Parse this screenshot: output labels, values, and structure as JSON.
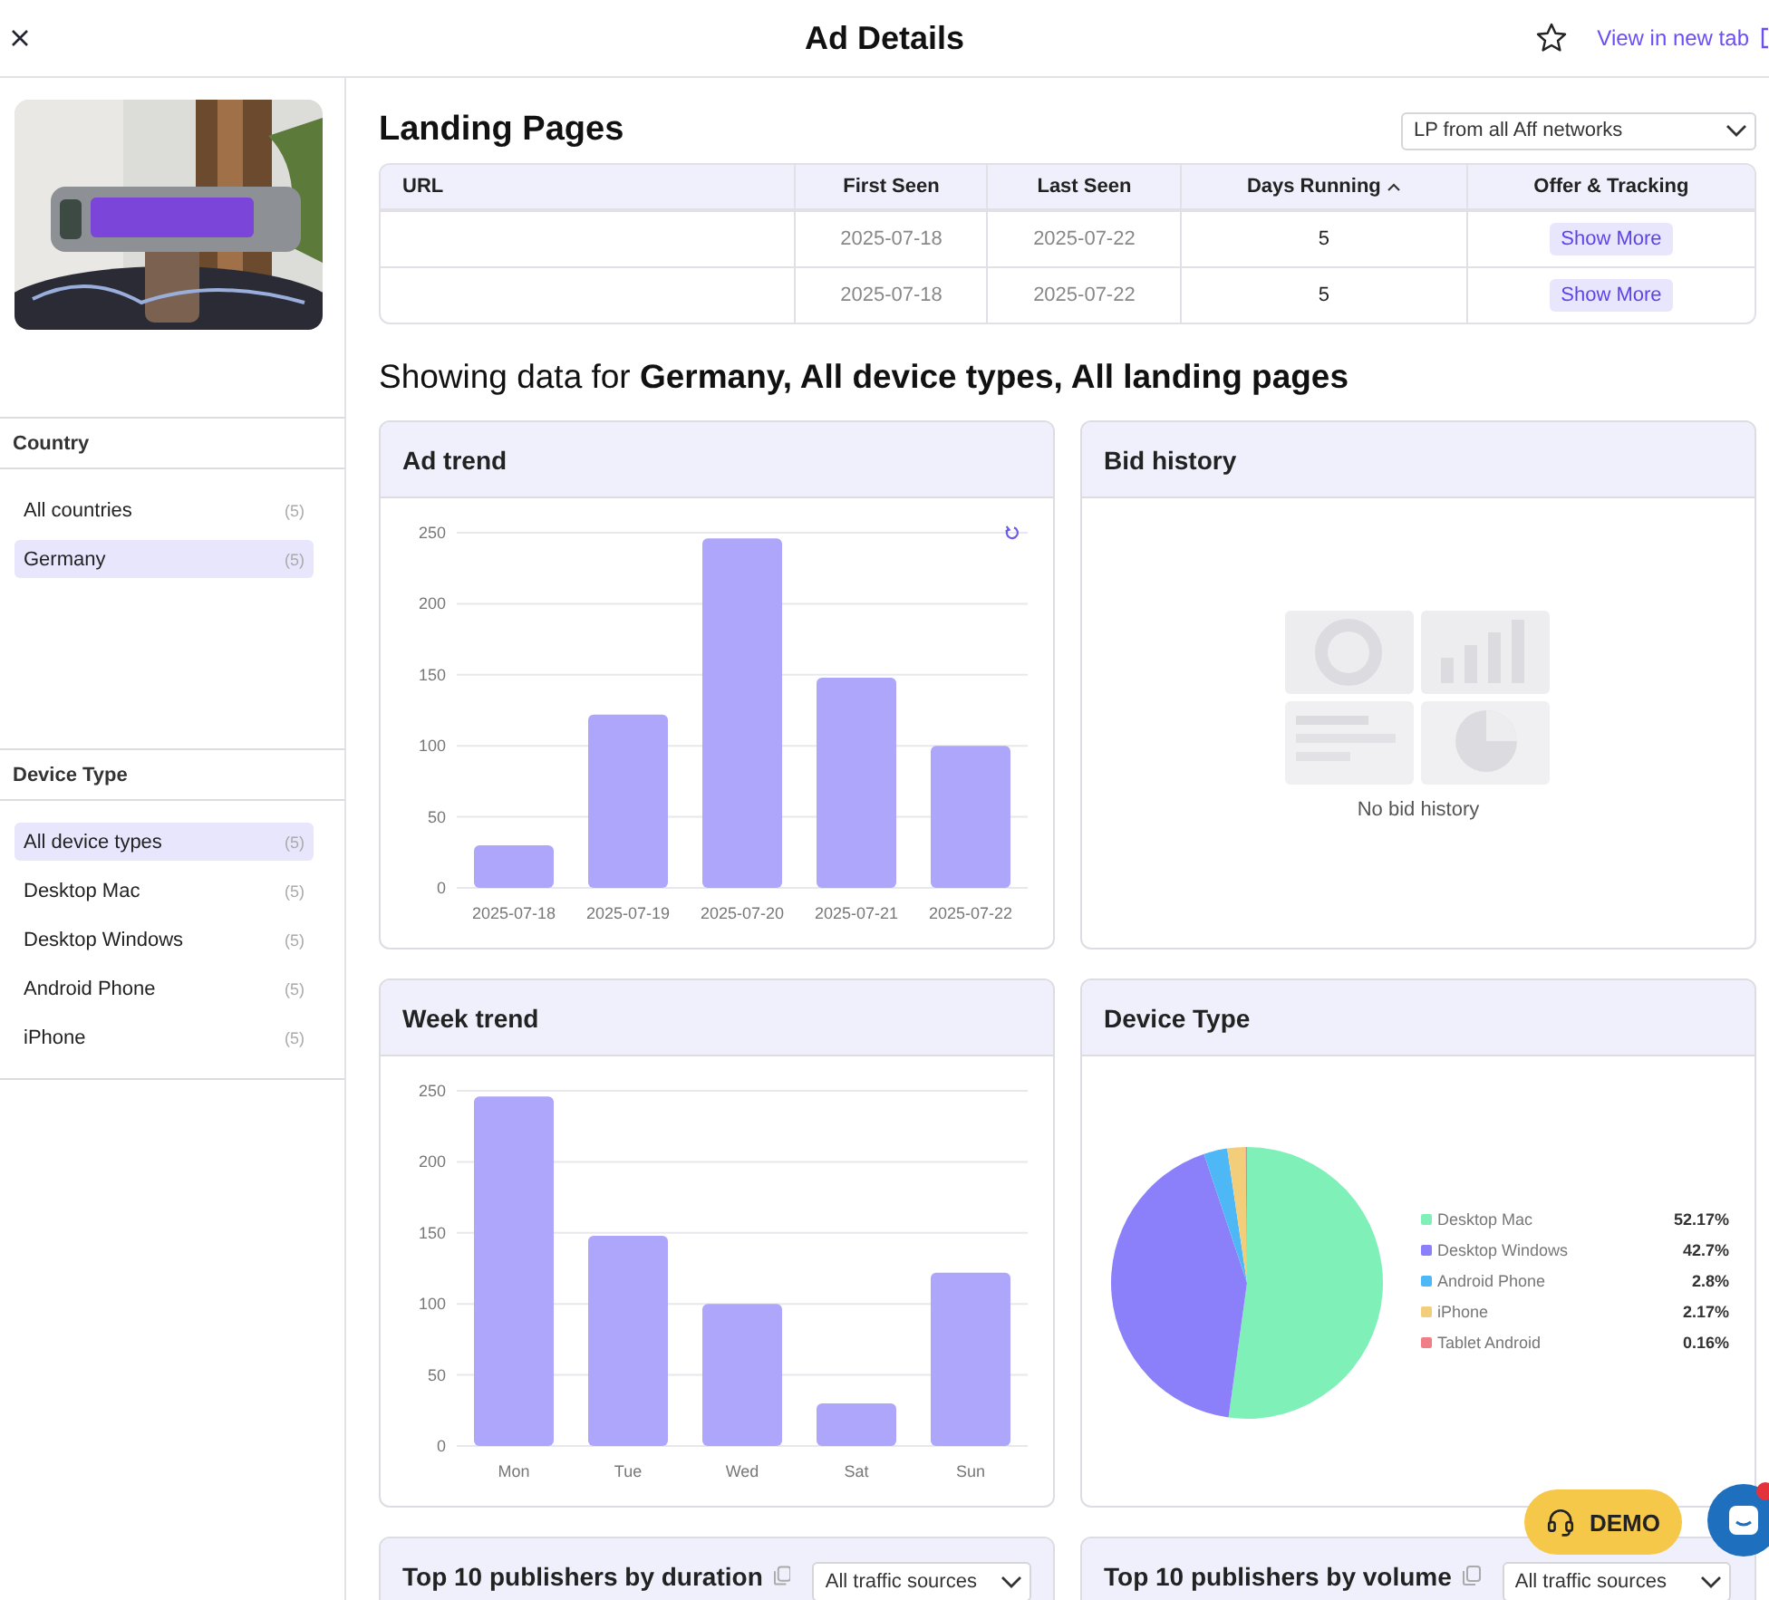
{
  "header": {
    "title": "Ad Details",
    "link": "View in new tab"
  },
  "sidebar": {
    "filters": [
      {
        "title": "Country",
        "items": [
          {
            "label": "All countries",
            "count": "(5)",
            "selected": false
          },
          {
            "label": "Germany",
            "count": "(5)",
            "selected": true
          }
        ]
      },
      {
        "title": "Device Type",
        "items": [
          {
            "label": "All device types",
            "count": "(5)",
            "selected": true
          },
          {
            "label": "Desktop Mac",
            "count": "(5)",
            "selected": false
          },
          {
            "label": "Desktop Windows",
            "count": "(5)",
            "selected": false
          },
          {
            "label": "Android Phone",
            "count": "(5)",
            "selected": false
          },
          {
            "label": "iPhone",
            "count": "(5)",
            "selected": false
          }
        ]
      }
    ]
  },
  "landing_pages": {
    "title": "Landing Pages",
    "dropdown": "LP from all Aff networks",
    "columns": [
      {
        "label": "URL",
        "sorted": false
      },
      {
        "label": "First Seen",
        "sorted": false
      },
      {
        "label": "Last Seen",
        "sorted": false
      },
      {
        "label": "Days Running",
        "sorted": true
      },
      {
        "label": "Offer & Tracking",
        "sorted": false
      }
    ],
    "rows": [
      {
        "first_seen": "2025-07-18",
        "last_seen": "2025-07-22",
        "days_running": "5",
        "action": "Show More"
      },
      {
        "first_seen": "2025-07-18",
        "last_seen": "2025-07-22",
        "days_running": "5",
        "action": "Show More"
      }
    ]
  },
  "summary": "Showing data for **Germany, All device types, All landing pages**",
  "cards": [
    {
      "kind": "bar",
      "title": "Ad trend",
      "refresh": true,
      "chart_data": {
        "type": "bar",
        "categories": [
          "2025-07-18",
          "2025-07-19",
          "2025-07-20",
          "2025-07-21",
          "2025-07-22"
        ],
        "series": [
          {
            "color": "#aea6fb",
            "values": [
              30,
              122,
              246,
              148,
              100
            ]
          }
        ],
        "ylim": [
          0,
          250
        ],
        "yticks": [
          0,
          50,
          100,
          150,
          200,
          250
        ],
        "grid": true
      }
    },
    {
      "kind": "empty",
      "title": "Bid history",
      "message": "No bid history"
    },
    {
      "kind": "bar",
      "title": "Week trend",
      "chart_data": {
        "type": "bar",
        "categories": [
          "Mon",
          "Tue",
          "Wed",
          "Sat",
          "Sun"
        ],
        "series": [
          {
            "color": "#aea6fb",
            "values": [
              246,
              148,
              100,
              30,
              122
            ]
          }
        ],
        "ylim": [
          0,
          250
        ],
        "yticks": [
          0,
          50,
          100,
          150,
          200,
          250
        ],
        "grid": true
      }
    },
    {
      "kind": "pie",
      "title": "Device Type",
      "chart_data": {
        "type": "pie",
        "categories": [
          "Desktop Mac",
          "Desktop Windows",
          "Android Phone",
          "iPhone",
          "Tablet Android"
        ],
        "series": [
          {
            "values": [
              52.17,
              42.7,
              2.8,
              2.17,
              0.16
            ]
          }
        ]
      },
      "legend": [
        {
          "value": "52.17%",
          "color": "#7ff0b8"
        },
        {
          "value": "42.7%",
          "color": "#8b80f9"
        },
        {
          "value": "2.8%",
          "color": "#4db8f5"
        },
        {
          "value": "2.17%",
          "color": "#f2cd7a"
        },
        {
          "value": "0.16%",
          "color": "#f07e86"
        }
      ]
    },
    {
      "kind": "publishers",
      "title": "Top 10 publishers by duration",
      "dropdown": "All traffic sources"
    },
    {
      "kind": "publishers",
      "title": "Top 10 publishers by volume",
      "dropdown": "All traffic sources"
    }
  ],
  "demo_button": "DEMO",
  "chat": {
    "unread": true
  }
}
